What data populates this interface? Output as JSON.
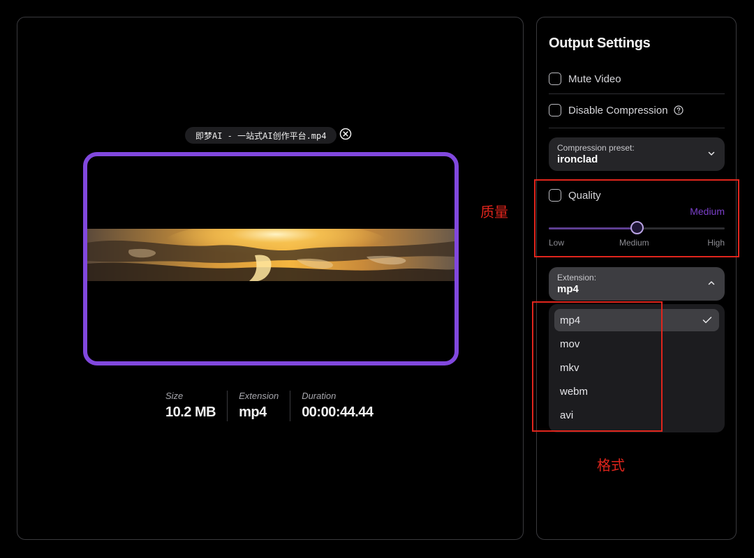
{
  "preview": {
    "file_name": "即梦AI - 一站式AI创作平台.mp4",
    "close_icon": "circle-x-icon"
  },
  "meta": [
    {
      "label": "Size",
      "value": "10.2 MB"
    },
    {
      "label": "Extension",
      "value": "mp4"
    },
    {
      "label": "Duration",
      "value": "00:00:44.44"
    }
  ],
  "settings": {
    "title": "Output Settings",
    "mute_video": {
      "label": "Mute Video",
      "checked": false
    },
    "disable_compression": {
      "label": "Disable Compression",
      "checked": false,
      "help_icon": "question-circle-icon"
    },
    "compression_preset": {
      "label": "Compression preset:",
      "value": "ironclad"
    },
    "quality": {
      "label": "Quality",
      "checked": false,
      "value_text": "Medium",
      "level": 0.5,
      "ticks": [
        "Low",
        "Medium",
        "High"
      ]
    },
    "extension": {
      "label": "Extension:",
      "value": "mp4",
      "open": true,
      "options": [
        "mp4",
        "mov",
        "mkv",
        "webm",
        "avi"
      ],
      "selected": "mp4"
    }
  },
  "annotations": {
    "quality_note": "质量",
    "format_note": "格式",
    "color": "#e0251c"
  },
  "colors": {
    "accent": "#8148de",
    "quality_text": "#7a3fc9"
  }
}
